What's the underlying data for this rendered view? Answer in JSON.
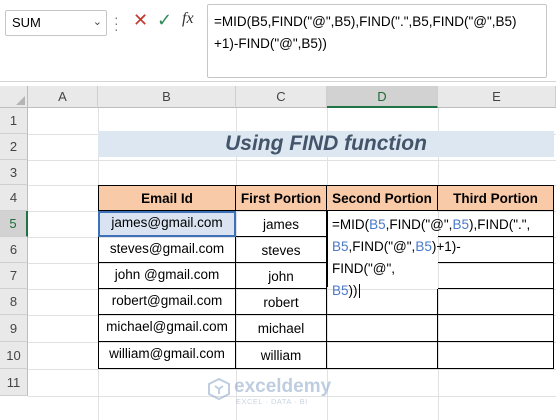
{
  "name_box": {
    "value": "SUM"
  },
  "formula_bar": {
    "line1": "=MID(B5,FIND(\"@\",B5),FIND(\".\",B5,FIND(\"@\",B5)",
    "line2": "+1)-FIND(\"@\",B5))",
    "fx_label": "fx"
  },
  "icons": {
    "cancel": "cancel-x-icon",
    "enter": "checkmark-icon",
    "more": "vertical-dots-icon"
  },
  "columns": [
    "A",
    "B",
    "C",
    "D",
    "E"
  ],
  "rows": [
    "1",
    "2",
    "3",
    "4",
    "5",
    "6",
    "7",
    "8",
    "9",
    "10",
    "11"
  ],
  "sheet": {
    "title": "Using FIND function",
    "headers": [
      "Email Id",
      "First Portion",
      "Second Portion",
      "Third Portion"
    ],
    "emails": [
      "james@gmail.com",
      "steves@gmail.com",
      "john @gmail.com",
      "robert@gmail.com",
      "michael@gmail.com",
      "william@gmail.com"
    ],
    "first_portions": [
      "james",
      "steves",
      "john",
      "robert",
      "michael",
      "william"
    ],
    "edit_formula": {
      "l1a": "=MID(",
      "l1b": "B5",
      "l1c": ",FIND(\"@\",",
      "l1d": "B5",
      "l1e": "),FIND(\".\",",
      "l2a": "B5",
      "l2b": ",FIND(\"@\",",
      "l2c": "B5",
      "l2d": ")+1)-FIND(\"@\",",
      "l3a": "B5",
      "l3b": "))"
    }
  },
  "watermark": {
    "name": "exceldemy",
    "tagline": "EXCEL · DATA · BI"
  },
  "colors": {
    "header_fill": "#f9caa8",
    "title_fill": "#dde7f1",
    "title_text": "#44546a",
    "ref_blue": "#4a79c9",
    "excel_green": "#217346"
  }
}
